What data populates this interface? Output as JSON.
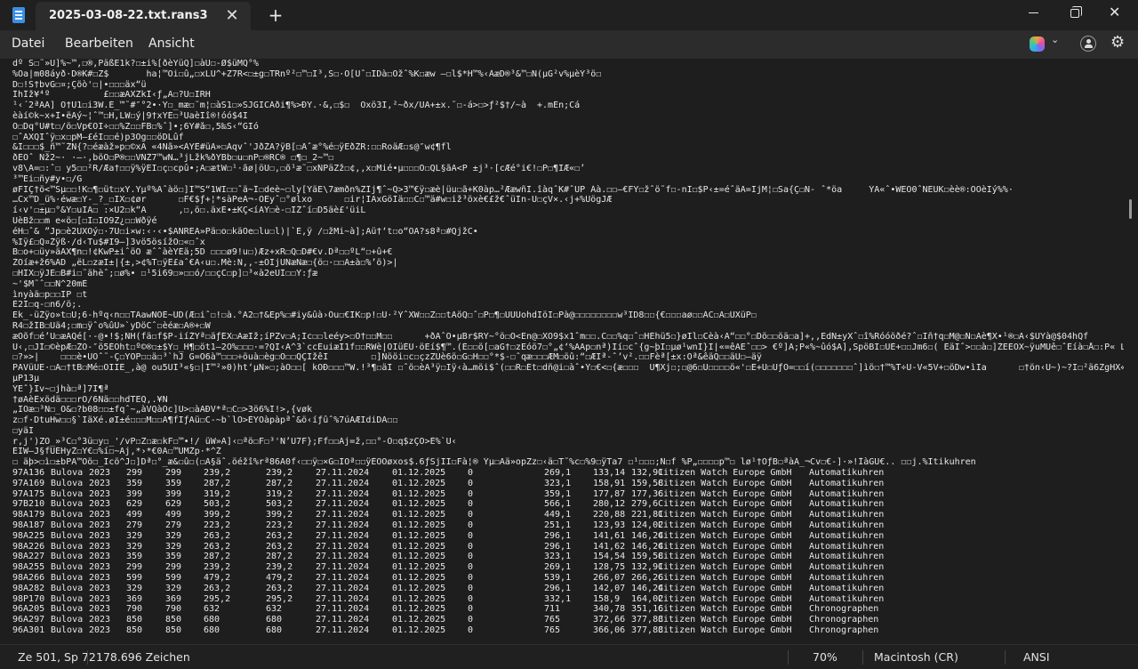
{
  "window": {
    "tab_title": "2025-03-08-22.txt.rans3",
    "tab_close_symbol": "✕",
    "new_tab_symbol": "+",
    "close_symbol": "✕"
  },
  "menu": {
    "items": [
      "Datei",
      "Bearbeiten",
      "Ansicht"
    ]
  },
  "editor": {
    "lines": [
      "dº S☐˜»U]%~™,☐®,PäßE1k?☐±i%[ðèYüQ]☐àU☐-Ø$üMQ°%",
      "%Oa|m08áyð·D®K#☐Z$       ha¦™Ôi☐û„☐xLÜ^+Z7R<☐±g☐TRnº²☐™☐I³,S☐·Ó[Ûˆ☐IDà☐Õžˆ%K☐æw –☐l$*H™%‹ÀæD®³&™☐N(µG²v%µèÝ³ö☐",
      "D☐!S†bvG☐¤;Çöò'☐|•☐☐☐äx“ü",
      "ÎhÎž¥⁴º          £☐☐æÄXZkÎ‹ƒ„Ä☐?U☐IRH",
      "¹‹´2ªÄÄ] Ö†Ü1☐i3W.È_™˜#″°2•·Y☐_mæ☐˜m¦☐àS1☐»SJGICÁði¶%>ÐŸ.·&,☐$☐  Öxö3Ï,²~ðx/ÚA+±x.˜☐-á>☐>ƒ²$†/~à  +.mÉn;Cá",
      "èàí©k~x+Î•ëÄý~¦ˆ™☐H,LW☐ý|9†xYÉ☐³ÚaèIî®!óó$4I",
      "Ö☐Dq°Ü#t☐/ö☐Vp€OI÷☐☐%Z☐☐FB☐%ˆ]•;6Y#å☐,5‰S‹“GIó",
      "☐ˆÄXQIˆÿ☐x☐pM–£éI☐☐é)p3Ög☐☐öDLûf",
      "&Í☐☐☐$_ñ™˜ŽÑ{?☐éæàž»p☐©xA «4Nã»<ÁYÊ#üA»☐Áqvˆ'JðŽA?ÿB[☐Ãˆæ°%é☐ÿEðŽR:☐☐RoäÆ☐s@″w¢¶fl",
      "ðÉÖˆ Ñž2~· ·–·,böÖ☐P®☐☐VÑŽ7™wN…³jLžk%ðYBb☐u☐nP☐®RC® ☐¶☐_2~™☐",
      "v8\\Ä=☐:ˆ☐ y5☐☐²R/Æa†☐☐ÿ%ÿEÏ☐ç☐cpû•;Ä☐ætW☐¹·ãø|öÜ☐,☐õ¹æ˜☐xÑPäZž☐¢,,x☐Mié•µ☐☐☐Ö☐QL§ãA<P ±j³·[cÆé°i€!☐P☐¶IÆ«☐’",
      "³™Ei☐ñy#y•☐/G",
      "øFIÇ†ö<™Sµ☐☐!K☐¶☐üt☐xY.Yµº%Äˆàö☐]I™S“1WI☐☐ˆä~Î☐deè~☐ly[ÝäE\\7æmðn%ZÎj¶ˆ~Q>3™€ÿ☐æè|üu☐ã+K0àp…²ÆæwñI.îàqˆK#ˆÚP Áà.☐☐–€FY☐žˆö˜f☐-nI☐$P‹±=éˆäA=ÏjM¦☐Sa{Ç☐N- ˆ*öa     ÝA«ˆ•WEÖ0ˆNEÜK☐èè®:ÖÖèIý%%·",
      "…Cx™D_ü%·éwæ☐Ÿ-_?_☐IX☐¢ør      ☐F€$ƒ+¦*sàPeA¬-ÖEyˆ☐°ølxo      ☐ir¦IAxGöIä☐☐C☐™ä#w☐iž³öxè€£ž€ˆüIn-Ü☐çV×.‹j+%UögJÆ",
      "í‹v'☐±µ☐°&Y☐uIÄ☐ :×U2☐k“Ä      ,☐,ö☐.äxÈ•±KÇ<íÄY☐è-☐IŽˆí☐D5äè£'üiL",
      "UèBž☐☐m e«ö☐[☐I☐IÖ9Z¿☐☐Wðÿé",
      "éH☐ˆ& ”Jp☐è2ÜXÖý☐·7Ü☐i×w:‹·‹•$ANREÄ»Pä☐o☐käÖe☐lu☐l)|`É,ÿ /☐žMi~à];Aü†‘t☐o“ÖA?s8ª☐#QjžC•",
      "%Iÿ£☐Q¤Žÿß·/d‹Tu$#I9–]3vö5ösížÖ☐«☐ˆx",
      "B☐o+☐üy»äÄX¶n☐!¢KwP±iˆöÓ æˆˆàèYÉä;5D ☐☐☐ø9!u☐)Æz+xR☐Q☐D#€v.Dª☐☐ºL“☐+û+€",
      "ŽOíæ+ž6%AD „ëL☐zæI±|{±,>¢%T☐ÿÊ£aˆ€Ä‹u☐.Mè:N,,-±ÖIjUÑæNæ☐{ö☐·☐☐Ä±à☐%’ö)>|",
      "☐HIX☐ÿJE☐B#i☐˜ähèˆ;☐ø%• ☐¹5i69☐»☐☐ó/☐☐çC☐p]☐³«à2eÜÎ☐☐Y:ƒæ",
      "~'$M˜ˆ☐☐N^20mÈ",
      "ìnyàä☐p☐☐IP ☐t",
      "È2I☐q-☐n6/ö;.",
      "Ëk_-üŽÿo»t☐U;6-hºq‹n☐☐TÄawNÖÈ~ÜD(Æ☐iˆ☐!☐à.°Ä2☐†&Ëp%☐#iy&ûà›Õu☐€IK☐p!☐Û·²ÝˆXW☐☐Z☐☐tÄöQ☐ˆ☐P☐¶☐UÛUohdIöI☐Pà@☐☐☐☐☐☐☐☐w³ID8☐☐{€☐☐☐aø☐☐ÁC☐Ä☐UXüP☐",
      "R4☐žÍB☐Uä4;☐m☐ÿˆo%ûU»`yDöCˆ☐èéæ☐Ä®+☐W",
      "æÖõf☐é’U☐æAQé[·-@•!$;ÑH(fä☐f$P-iíŽYª☐äƒÉX☐AæIž;íPZv☐A;Ic☐☐leéy>☐Ö†☐☐M☐☐      +ðAˆÖ•µBr$RY~°ö☐O<En@☐XÖ9$x1ˆm☐☐.C☐☐%q☐ˆ☐HÉhü5☐}øIl☐Cèà‹Ä“☐☐°☐Dö☐☐öä☐a]+,,ËdÑ±yXˆ☐î%Róóöðé?ˆ☐Iñ†q☐M@☐Ñ☐Äè¶X•¹®☐Ä‹$UYà@$04hQf",
      "U‹,☐JÍ☐©èpÆ☐ŽO-″ö5ÉÖht☐º©®☐±$Y☐_H¶☐öt1–2O%☐☐☐·=?QI‹Ä^3`ccÉuiæI1f☐☐RWè|ÖIüÉU·öEí$¶™.(È☐☐ö[☐aG†☐zËóö7☐°„¢‘%AÄp☐nª)Ií☐cˆ{g~þI☐µø¹wnÍ}I|«=êÄEˆ☐☐> €º]Ä;P«%~ûó$A],SpöBI☐UÈ+☐☐Jm6☐( ÈäIˆ>☐☐à☐]ŽËEOX~ÿuMUê☐ˆÊíà☐Å☐:P« L6I☐º ☐☐-i³p☐H",
      "☐?»>|    ☐☐☐è•UÖˆ˜-Ç☐YÖP☐☐ä☐³`hJ G=Ö6à™☐☐☐÷öuà☐èg☐O☐☐QÇIžêI        ☐]Nööi☐c☐çzZUè6ö☐G☐H☐☐°*$-☐ˆqæ☐☐☐ÆM☐öû:“☐ÆIª-ˆ’v².☐☐Fèª[±x:Öª&êäQ☐☐äU☐–äÿ",
      "PÄVüUE·☐Ä☐†tB☐Mé☐OIÏÉ_,à@ ou5UI³«§☐|I™²»0)ht‘µÑ»☐;àÖ☐☐[ kOÐ☐☐☐™W.!³¶☐äI ☐ˆö☐èA³ÿ☐Iÿ‹à…möi$ˆ(☐☐R☐Ét☐dñ@i☐àˆ•Ý☐€<☐{æ☐☐☐  U¶Xj☐;☐@6☐U☐☐☐☐ö«'☐E+Ü☐ÜƒÖ=☐☐í(☐☐☐☐☐☐☐ˆ]ìö☐†™%T÷Ù-V«5V+☐öDw•ìIa      ☐†ön‹Û~)~?I☐²ä6ZgHX«ÑÆEG☐%I☐`R¥³GrA^7JGIIC☐SC‹/",
      "µP13µ",
      "ÝEˆ}Iv~☐jhà☐ª]7I¶ª",
      "†øAèÈxödä☐☐☐rÖ/6Ñä☐☐hdTEQ,.¥N",
      "„IÖæ☐³N☐_Ö&☐?b08☐☐±fqˆ~„àVQàÖc]U>☐àÄÐV*ª☐C☐>3ö6%I!>,{vøk",
      "z☐f·DtuHw☐☐§`IäXé.øI±é☐☐☐M☐☐Ä¶fIƒÄü☐C-~b`lO>ÈYÖàpàpªˆ&ö‹íƒûˆ%7úÄÆIdiDÄ☐☐",
      "☐yäI",
      "r,j')ZÖ_»³C☐°3ü☐y☐_'/vP☐Z☐æ☐kF☐™•!/ üW»A]‹☐ªö☐F☐³'N’U7F};Ff☐☐Äj=ž,☐☐°-Ö☐q$zÇÖ>È%`Ü‹",
      "ÈIW–J§fÜÉHyŽ☐Y€☐%í☐~Äj,*›*€0Ä☐™UMŽp·*^Ž",
      "☐ äþ>☐ì☐±bPA™Öö☐_Ìcö^J☐]Dª☐°_æ&☐û☐(☐A§äˆ.öéžî%rª86A0f‹☐☐ÿ☐×G☐IÖª☐☐ÿÈÖOøxos$.6ƒSjII☐Fà¦® Ýµ☐Ää»opZz☐‹ä☐T˜%c☐%9☐ÿTa7 ☐¹☐☐☐;Ñ☐f %P„☐☐☐☐p™☐ lø¹†ÖƒB☐ªàÄ_¬Cv☐€-]·»!ÎàGÜ€.. ☐☐j.%Itikuhren"
    ],
    "table_rows": [
      [
        "97A136",
        "Bulova",
        "2023",
        "299",
        "299",
        "239,2",
        "239,2",
        "27.11.2024",
        "01.12.2025",
        "0",
        "269,1",
        "133,14",
        "132,91",
        "Citizen Watch Europe GmbH",
        "Automatikuhren"
      ],
      [
        "97A169",
        "Bulova",
        "2023",
        "359",
        "359",
        "287,2",
        "287,2",
        "27.11.2024",
        "01.12.2025",
        "0",
        "323,1",
        "158,91",
        "159,58",
        "Citizen Watch Europe GmbH",
        "Automatikuhren"
      ],
      [
        "97A175",
        "Bulova",
        "2023",
        "399",
        "399",
        "319,2",
        "319,2",
        "27.11.2024",
        "01.12.2025",
        "0",
        "359,1",
        "177,87",
        "177,36",
        "Citizen Watch Europe GmbH",
        "Automatikuhren"
      ],
      [
        "97B210",
        "Bulova",
        "2023",
        "629",
        "629",
        "503,2",
        "503,2",
        "27.11.2024",
        "01.12.2025",
        "0",
        "566,1",
        "280,12",
        "279,6",
        "Citizen Watch Europe GmbH",
        "Automatikuhren"
      ],
      [
        "98A179",
        "Bulova",
        "2023",
        "499",
        "499",
        "399,2",
        "399,2",
        "27.11.2024",
        "01.12.2025",
        "0",
        "449,1",
        "220,88",
        "221,81",
        "Citizen Watch Europe GmbH",
        "Automatikuhren"
      ],
      [
        "98A187",
        "Bulova",
        "2023",
        "279",
        "279",
        "223,2",
        "223,2",
        "27.11.2024",
        "01.12.2025",
        "0",
        "251,1",
        "123,93",
        "124,02",
        "Citizen Watch Europe GmbH",
        "Automatikuhren"
      ],
      [
        "98A225",
        "Bulova",
        "2023",
        "329",
        "329",
        "263,2",
        "263,2",
        "27.11.2024",
        "01.12.2025",
        "0",
        "296,1",
        "141,61",
        "146,24",
        "Citizen Watch Europe GmbH",
        "Automatikuhren"
      ],
      [
        "98A226",
        "Bulova",
        "2023",
        "329",
        "329",
        "263,2",
        "263,2",
        "27.11.2024",
        "01.12.2025",
        "0",
        "296,1",
        "141,62",
        "146,24",
        "Citizen Watch Europe GmbH",
        "Automatikuhren"
      ],
      [
        "98A227",
        "Bulova",
        "2023",
        "359",
        "359",
        "287,2",
        "287,2",
        "27.11.2024",
        "01.12.2025",
        "0",
        "323,1",
        "154,54",
        "159,58",
        "Citizen Watch Europe GmbH",
        "Automatikuhren"
      ],
      [
        "98A255",
        "Bulova",
        "2023",
        "299",
        "299",
        "239,2",
        "239,2",
        "27.11.2024",
        "01.12.2025",
        "0",
        "269,1",
        "128,75",
        "132,91",
        "Citizen Watch Europe GmbH",
        "Automatikuhren"
      ],
      [
        "98A266",
        "Bulova",
        "2023",
        "599",
        "599",
        "479,2",
        "479,2",
        "27.11.2024",
        "01.12.2025",
        "0",
        "539,1",
        "266,07",
        "266,26",
        "Citizen Watch Europe GmbH",
        "Automatikuhren"
      ],
      [
        "98A282",
        "Bulova",
        "2023",
        "329",
        "329",
        "263,2",
        "263,2",
        "27.11.2024",
        "01.12.2025",
        "0",
        "296,1",
        "142,07",
        "146,24",
        "Citizen Watch Europe GmbH",
        "Automatikuhren"
      ],
      [
        "98P170",
        "Bulova",
        "2023",
        "369",
        "369",
        "295,2",
        "295,2",
        "27.11.2024",
        "01.12.2025",
        "0",
        "332,1",
        "158,9",
        "164,02",
        "Citizen Watch Europe GmbH",
        "Automatikuhren"
      ],
      [
        "96A205",
        "Bulova",
        "2023",
        "790",
        "790",
        "632",
        "632",
        "27.11.2024",
        "01.12.2025",
        "0",
        "711",
        "340,78",
        "351,16",
        "Citizen Watch Europe GmbH",
        "Chronographen"
      ],
      [
        "96A297",
        "Bulova",
        "2023",
        "850",
        "850",
        "680",
        "680",
        "27.11.2024",
        "01.12.2025",
        "0",
        "765",
        "372,66",
        "377,83",
        "Citizen Watch Europe GmbH",
        "Chronographen"
      ],
      [
        "96A301",
        "Bulova",
        "2023",
        "850",
        "850",
        "680",
        "680",
        "27.11.2024",
        "01.12.2025",
        "0",
        "765",
        "366,06",
        "377,83",
        "Citizen Watch Europe GmbH",
        "Chronographen"
      ]
    ]
  },
  "status": {
    "position": "Ze 501, Sp 72",
    "char_count": "178.696 Zeichen",
    "zoom": "70%",
    "line_ending": "Macintosh (CR)",
    "encoding": "ANSI"
  }
}
